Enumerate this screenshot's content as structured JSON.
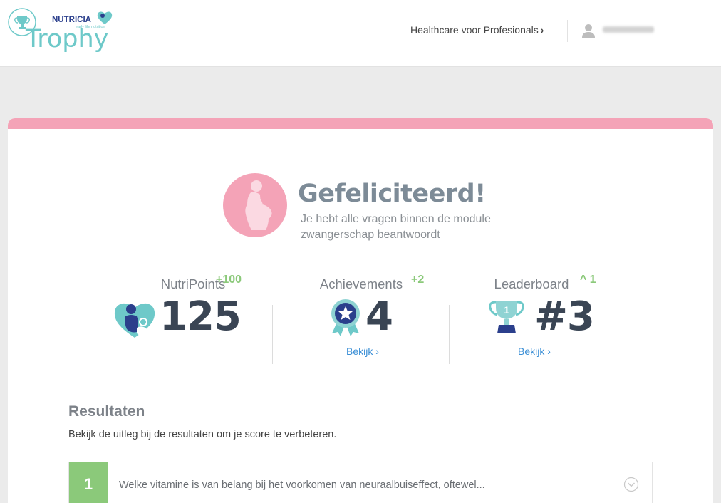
{
  "header": {
    "logo": {
      "brand": "NUTRICIA",
      "tagline": "early life nutrition",
      "word": "Trophy"
    },
    "hcp_link": "Healthcare voor Profesionals",
    "hcp_chevron": "›",
    "user": {
      "icon": "user-silhouette-icon",
      "name_redacted": true
    }
  },
  "colors": {
    "pink": "#f4a3b7",
    "green": "#8bc97a",
    "teal": "#6ec9c9",
    "navy": "#2b3f8c",
    "link": "#3b8fd6"
  },
  "congrats": {
    "title": "Gefeliciteerd!",
    "subtitle": "Je hebt alle vragen binnen de module zwangerschap beantwoordt",
    "icon": "pregnant-woman-icon"
  },
  "stats": [
    {
      "label": "NutriPoints",
      "delta": "+100",
      "value": "125",
      "icon": "nutricia-heart-icon",
      "link": ""
    },
    {
      "label": "Achievements",
      "delta": "+2",
      "value": "4",
      "icon": "rosette-star-icon",
      "link": "Bekijk ›"
    },
    {
      "label": "Leaderboard",
      "delta": "^ 1",
      "value": "#3",
      "icon": "trophy-cup-icon",
      "link": "Bekijk ›"
    }
  ],
  "results": {
    "title": "Resultaten",
    "subtitle": "Bekijk de uitleg bij de resultaten om je score te verbeteren.",
    "questions": [
      {
        "number": "1",
        "text": "Welke vitamine is van belang bij het voorkomen van neuraalbuiseffect, oftewel...",
        "toggle_icon": "chevron-down-circle-icon"
      }
    ]
  }
}
